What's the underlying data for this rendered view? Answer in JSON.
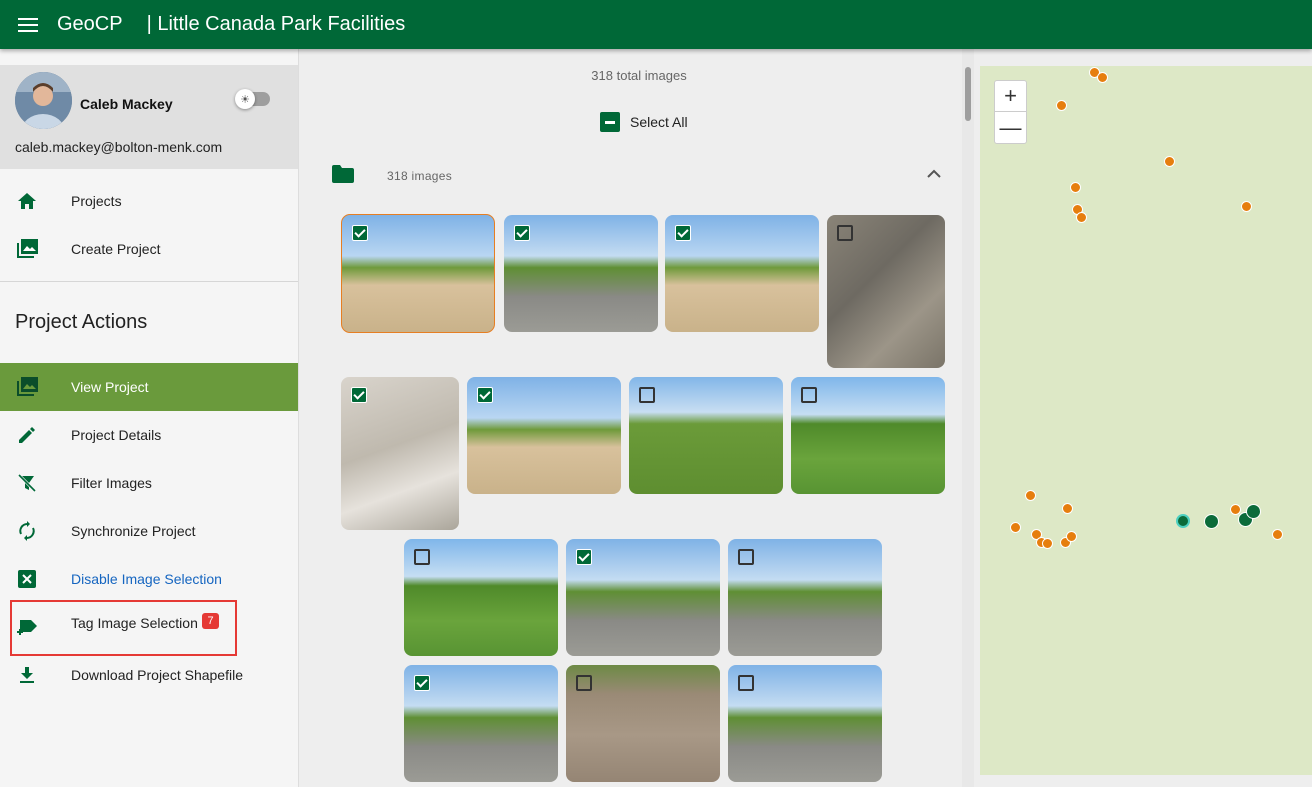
{
  "header": {
    "app_name": "GeoCP",
    "project_title": "| Little Canada Park Facilities"
  },
  "user": {
    "name": "Caleb Mackey",
    "email": "caleb.mackey@bolton-menk.com"
  },
  "nav": {
    "projects": "Projects",
    "create_project": "Create Project"
  },
  "project_actions": {
    "title": "Project Actions",
    "view_project": "View Project",
    "project_details": "Project Details",
    "filter_images": "Filter Images",
    "synchronize_project": "Synchronize Project",
    "disable_image_selection": "Disable Image Selection",
    "tag_image_selection": "Tag Image Selection",
    "tag_badge": "7",
    "download_shapefile": "Download Project Shapefile"
  },
  "gallery": {
    "total_label": "318 total images",
    "select_all": "Select All",
    "folder_count": "318 images",
    "thumbnails": [
      {
        "checked": true
      },
      {
        "checked": true
      },
      {
        "checked": true
      },
      {
        "checked": false
      },
      {
        "checked": true
      },
      {
        "checked": true
      },
      {
        "checked": false
      },
      {
        "checked": false
      },
      {
        "checked": false
      },
      {
        "checked": true
      },
      {
        "checked": false
      },
      {
        "checked": true
      },
      {
        "checked": false
      },
      {
        "checked": false
      }
    ]
  },
  "map": {
    "zoom_in": "+",
    "zoom_out": "—"
  },
  "colors": {
    "brand": "#006837",
    "active": "#6a9a3c",
    "accent": "#e67e22",
    "badge": "#e53935",
    "map_bg": "#dde8c6"
  }
}
